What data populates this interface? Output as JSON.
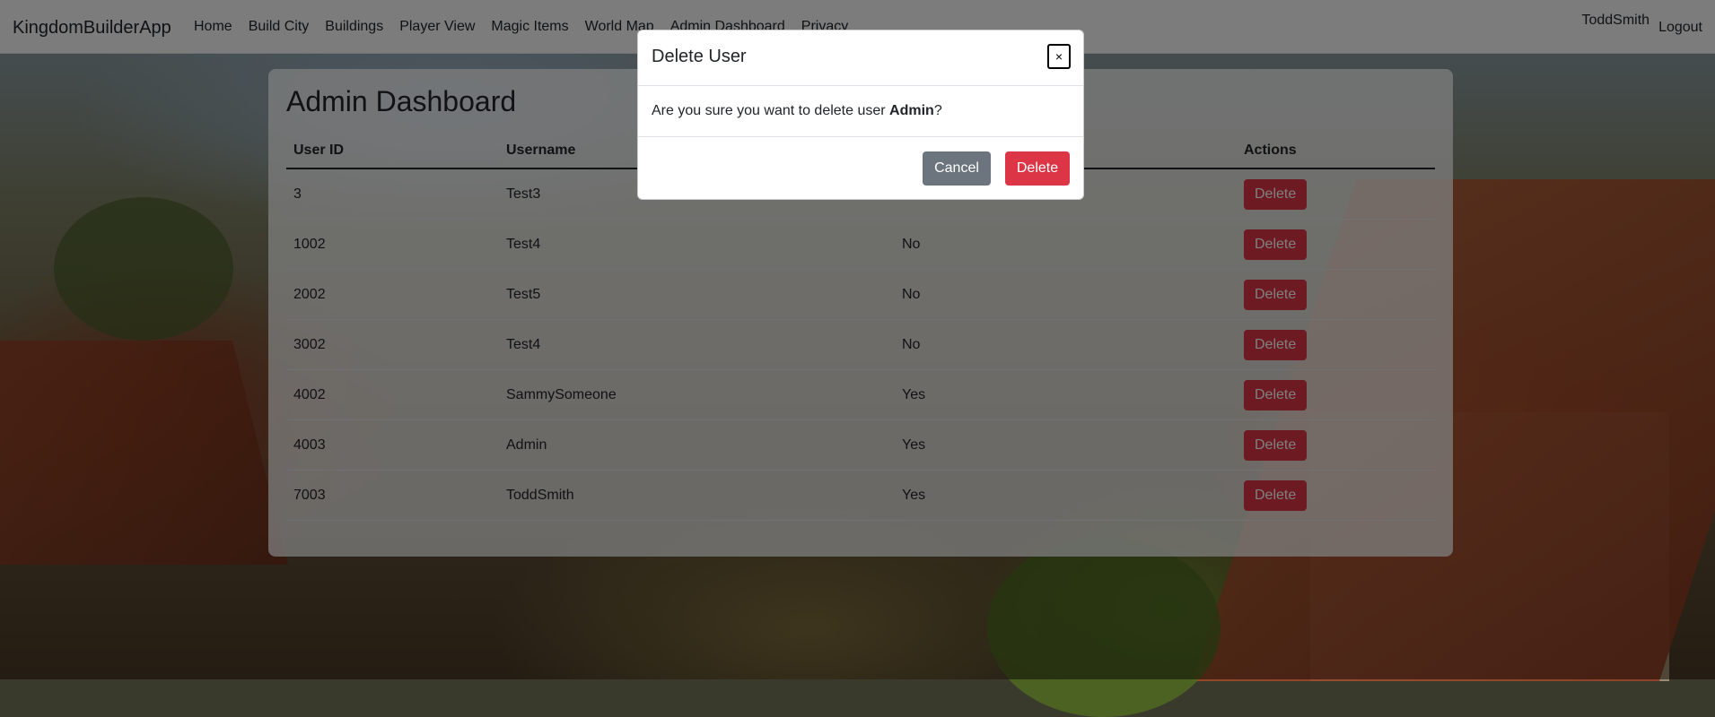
{
  "navbar": {
    "brand": "KingdomBuilderApp",
    "links": [
      "Home",
      "Build City",
      "Buildings",
      "Player View",
      "Magic Items",
      "World Map",
      "Admin Dashboard",
      "Privacy"
    ],
    "user": "ToddSmith",
    "logout": "Logout"
  },
  "dashboard": {
    "title": "Admin Dashboard",
    "columns": [
      "User ID",
      "Username",
      "",
      "Actions"
    ],
    "rows": [
      {
        "id": "3",
        "username": "Test3",
        "admin": "",
        "action": "Delete"
      },
      {
        "id": "1002",
        "username": "Test4",
        "admin": "No",
        "action": "Delete"
      },
      {
        "id": "2002",
        "username": "Test5",
        "admin": "No",
        "action": "Delete"
      },
      {
        "id": "3002",
        "username": "Test4",
        "admin": "No",
        "action": "Delete"
      },
      {
        "id": "4002",
        "username": "SammySomeone",
        "admin": "Yes",
        "action": "Delete"
      },
      {
        "id": "4003",
        "username": "Admin",
        "admin": "Yes",
        "action": "Delete"
      },
      {
        "id": "7003",
        "username": "ToddSmith",
        "admin": "Yes",
        "action": "Delete"
      }
    ]
  },
  "modal": {
    "title": "Delete User",
    "close": "×",
    "message_prefix": "Are you sure you want to delete user ",
    "target_user": "Admin",
    "message_suffix": "?",
    "cancel": "Cancel",
    "confirm": "Delete"
  },
  "colors": {
    "danger": "#dc3545",
    "secondary": "#6c757d",
    "navbar_bg": "#f8f9fa"
  }
}
